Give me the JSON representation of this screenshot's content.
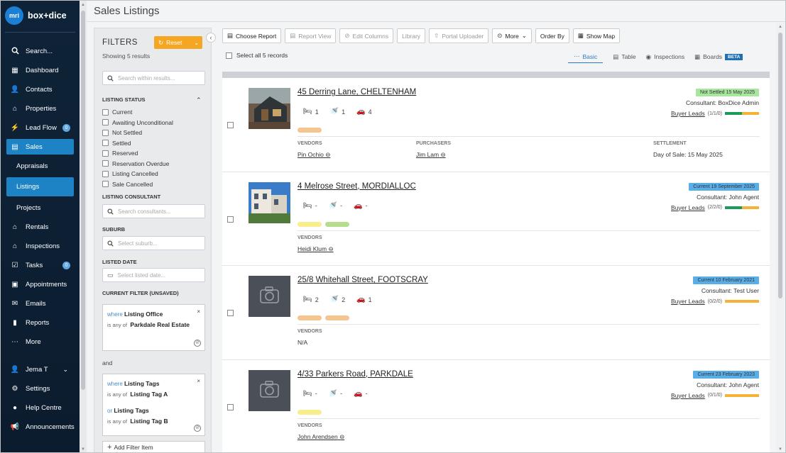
{
  "sidebar": {
    "logo_badge": "mri",
    "logo_text": "box+dice",
    "items": [
      {
        "label": "Search...",
        "icon": "search-icon"
      },
      {
        "label": "Dashboard",
        "icon": "grid-icon"
      },
      {
        "label": "Contacts",
        "icon": "user-icon"
      },
      {
        "label": "Properties",
        "icon": "home-icon"
      },
      {
        "label": "Lead Flow",
        "icon": "lead-flow-icon",
        "badge": "0"
      },
      {
        "label": "Sales",
        "icon": "sales-icon",
        "active": true
      },
      {
        "label": "Appraisals",
        "sub": true
      },
      {
        "label": "Listings",
        "sub": true,
        "active": true
      },
      {
        "label": "Projects",
        "sub": true
      },
      {
        "label": "Rentals",
        "icon": "home-icon"
      },
      {
        "label": "Inspections",
        "icon": "home-icon"
      },
      {
        "label": "Tasks",
        "icon": "tasks-icon",
        "badge": "0"
      },
      {
        "label": "Appointments",
        "icon": "calendar-icon"
      },
      {
        "label": "Emails",
        "icon": "mail-icon"
      },
      {
        "label": "Reports",
        "icon": "reports-icon"
      },
      {
        "label": "More",
        "icon": "more-icon"
      }
    ],
    "user_name": "Jema T",
    "settings": "Settings",
    "help": "Help Centre",
    "announcements": "Announcements"
  },
  "page_title": "Sales Listings",
  "filters": {
    "title": "FILTERS",
    "reset": "Reset",
    "count": "Showing 5 results",
    "search_placeholder": "Search within results...",
    "listing_status_label": "LISTING STATUS",
    "statuses": [
      "Current",
      "Awaiting Unconditional",
      "Not Settled",
      "Settled",
      "Reserved",
      "Reservation Overdue",
      "Listing Cancelled",
      "Sale Cancelled"
    ],
    "consultant_label": "LISTING CONSULTANT",
    "consultant_placeholder": "Search consultants...",
    "suburb_label": "SUBURB",
    "suburb_placeholder": "Select suburb...",
    "date_label": "LISTED DATE",
    "date_placeholder": "Select listed date...",
    "current_filter_label": "CURRENT FILTER (UNSAVED)",
    "rule1": {
      "where": "where",
      "field": "Listing Office",
      "op": "is any of",
      "value": "Parkdale Real Estate"
    },
    "and": "and",
    "rule2": {
      "where": "where",
      "field": "Listing Tags",
      "op": "is any of",
      "value": "Listing Tag A",
      "or": "or",
      "field2": "Listing Tags",
      "op2": "is any of",
      "value2": "Listing Tag B"
    },
    "add_filter": "Add Filter Item"
  },
  "toolbar": {
    "choose_report": "Choose Report",
    "report_view": "Report View",
    "edit_columns": "Edit Columns",
    "library": "Library",
    "portal_uploader": "Portal Uploader",
    "more": "More",
    "order_by": "Order By",
    "show_map": "Show Map"
  },
  "select_all": "Select all 5 records",
  "views": {
    "basic": "Basic",
    "table": "Table",
    "inspections": "Inspections",
    "boards": "Boards",
    "beta": "BETA"
  },
  "colors": {
    "sidebar": "#0f2338",
    "accent": "#1d83c5",
    "reset": "#f5a623",
    "status_green": "#a8e6a0",
    "status_blue": "#5aaee8"
  },
  "labels": {
    "vendors": "VENDORS",
    "purchasers": "PURCHASERS",
    "settlement": "SETTLEMENT",
    "buyer_leads": "Buyer Leads"
  },
  "listings": [
    {
      "address": "45 Derring Lane, CHELTENHAM",
      "beds": "1",
      "baths": "1",
      "cars": "4",
      "status": "Not Settled 15 May 2025",
      "consultant": "Consultant: BoxDice Admin",
      "leads_count": "(1/1/0)",
      "vendor": "Pin Ochio",
      "purchaser": "Jim Lam",
      "settlement": "Day of Sale: 15 May 2025"
    },
    {
      "address": "4 Melrose Street, MORDIALLOC",
      "beds": "-",
      "baths": "-",
      "cars": "-",
      "status": "Current 19 September 2025",
      "consultant": "Consultant: John Agent",
      "leads_count": "(2/2/0)",
      "vendor": "Heidi Klum"
    },
    {
      "address": "25/8 Whitehall Street, FOOTSCRAY",
      "beds": "2",
      "baths": "2",
      "cars": "1",
      "status": "Current 10 February 2021",
      "consultant": "Consultant: Test User",
      "leads_count": "(0/2/0)",
      "vendor": "N/A"
    },
    {
      "address": "4/33 Parkers Road, PARKDALE",
      "beds": "-",
      "baths": "-",
      "cars": "-",
      "status": "Current 23 February 2023",
      "consultant": "Consultant: John Agent",
      "leads_count": "(0/1/0)",
      "vendor": "John Arendsen"
    }
  ]
}
